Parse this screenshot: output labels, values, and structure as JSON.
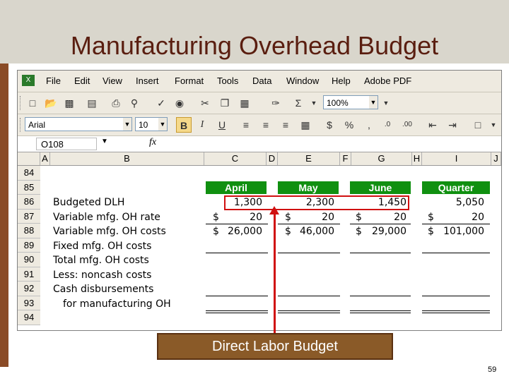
{
  "slide": {
    "title": "Manufacturing Overhead Budget",
    "callout_label": "Direct Labor Budget",
    "page_number": "59"
  },
  "excel": {
    "menu": [
      "File",
      "Edit",
      "View",
      "Insert",
      "Format",
      "Tools",
      "Data",
      "Window",
      "Help",
      "Adobe PDF"
    ],
    "zoom": "100%",
    "font_name": "Arial",
    "font_size": "10",
    "name_box": "O108",
    "fx_label": "fx",
    "columns": [
      "A",
      "B",
      "C",
      "D",
      "E",
      "F",
      "G",
      "H",
      "I",
      "J"
    ],
    "rows": [
      "84",
      "85",
      "86",
      "87",
      "88",
      "89",
      "90",
      "91",
      "92",
      "93",
      "94"
    ],
    "month_headers": [
      "April",
      "May",
      "June",
      "Quarter"
    ],
    "labels": [
      "Budgeted DLH",
      "Variable mfg. OH rate",
      "Variable mfg. OH costs",
      "Fixed mfg. OH costs",
      "Total mfg. OH costs",
      "Less: noncash costs",
      "Cash disbursements",
      "for manufacturing OH"
    ],
    "dlh": [
      "1,300",
      "2,300",
      "1,450",
      "5,050"
    ],
    "rate": [
      "20",
      "20",
      "20",
      "20"
    ],
    "var_costs": [
      "26,000",
      "46,000",
      "29,000",
      "101,000"
    ],
    "dollar": "$",
    "header_color": "#109010",
    "accent_red": "#d01010"
  }
}
